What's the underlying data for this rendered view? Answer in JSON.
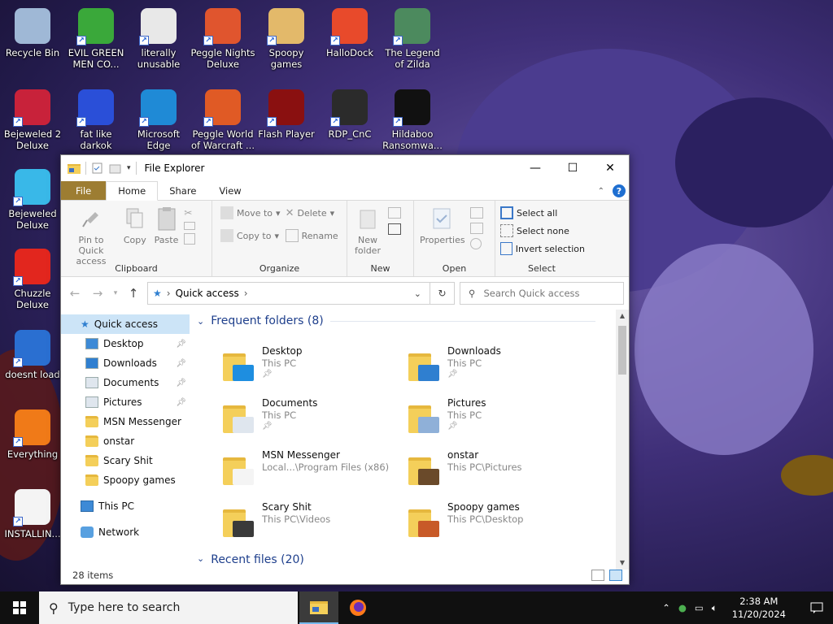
{
  "desktop": {
    "icons": [
      {
        "label": "Recycle Bin",
        "color": "#9fb8d6"
      },
      {
        "label": "EVIL GREEN MEN CO...",
        "color": "#3aa83a"
      },
      {
        "label": "literally unusable",
        "color": "#e8e8e8"
      },
      {
        "label": "Peggle Nights Deluxe",
        "color": "#e0552e"
      },
      {
        "label": "Spoopy games",
        "color": "#e3b96a"
      },
      {
        "label": "HalloDock",
        "color": "#e84a2b"
      },
      {
        "label": "The Legend of Zilda",
        "color": "#4c8a5e"
      },
      {
        "label": "Bejeweled 2 Deluxe",
        "color": "#c8223a"
      },
      {
        "label": "fat like darkok",
        "color": "#2a4fd8"
      },
      {
        "label": "Microsoft Edge",
        "color": "#1f8ad6"
      },
      {
        "label": "Peggle World of Warcraft ...",
        "color": "#e05a25"
      },
      {
        "label": "Flash Player",
        "color": "#8a1010"
      },
      {
        "label": "RDP_CnC",
        "color": "#2b2b2b"
      },
      {
        "label": "Hildaboo Ransomwa...",
        "color": "#111111"
      },
      {
        "label": "Bejeweled Deluxe",
        "color": "#39b8e8"
      },
      {
        "label": "Chuzzle Deluxe",
        "color": "#e2261e"
      },
      {
        "label": "doesnt load",
        "color": "#2a6fd1"
      },
      {
        "label": "Everything",
        "color": "#f07a18"
      },
      {
        "label": "INSTALLIN...",
        "color": "#f4f4f4"
      }
    ]
  },
  "explorer": {
    "title": "File Explorer",
    "tabs": {
      "file": "File",
      "home": "Home",
      "share": "Share",
      "view": "View"
    },
    "help": "?",
    "ribbon": {
      "clipboard": {
        "name": "Clipboard",
        "pin": "Pin to Quick access",
        "copy": "Copy",
        "paste": "Paste"
      },
      "organize": {
        "name": "Organize",
        "move_to": "Move to",
        "copy_to": "Copy to",
        "delete": "Delete",
        "rename": "Rename"
      },
      "new": {
        "name": "New",
        "new_folder": "New folder"
      },
      "open": {
        "name": "Open",
        "properties": "Properties"
      },
      "select": {
        "name": "Select",
        "select_all": "Select all",
        "select_none": "Select none",
        "invert": "Invert selection"
      }
    },
    "address": {
      "location": "Quick access",
      "search_placeholder": "Search Quick access"
    },
    "nav": {
      "quick_access": "Quick access",
      "items": [
        "Desktop",
        "Downloads",
        "Documents",
        "Pictures",
        "MSN Messenger",
        "onstar",
        "Scary Shit",
        "Spoopy games"
      ],
      "this_pc": "This PC",
      "network": "Network"
    },
    "frequent_title": "Frequent folders (8)",
    "recent_title": "Recent files (20)",
    "folders": [
      {
        "name": "Desktop",
        "sub": "This PC",
        "pinned": true
      },
      {
        "name": "Downloads",
        "sub": "This PC",
        "pinned": true
      },
      {
        "name": "Documents",
        "sub": "This PC",
        "pinned": true
      },
      {
        "name": "Pictures",
        "sub": "This PC",
        "pinned": true
      },
      {
        "name": "MSN Messenger",
        "sub": "Local...\\Program Files (x86)",
        "pinned": false
      },
      {
        "name": "onstar",
        "sub": "This PC\\Pictures",
        "pinned": false
      },
      {
        "name": "Scary Shit",
        "sub": "This PC\\Videos",
        "pinned": false
      },
      {
        "name": "Spoopy games",
        "sub": "This PC\\Desktop",
        "pinned": false
      }
    ],
    "status": "28 items"
  },
  "taskbar": {
    "search_placeholder": "Type here to search",
    "time": "2:38 AM",
    "date": "11/20/2024"
  }
}
